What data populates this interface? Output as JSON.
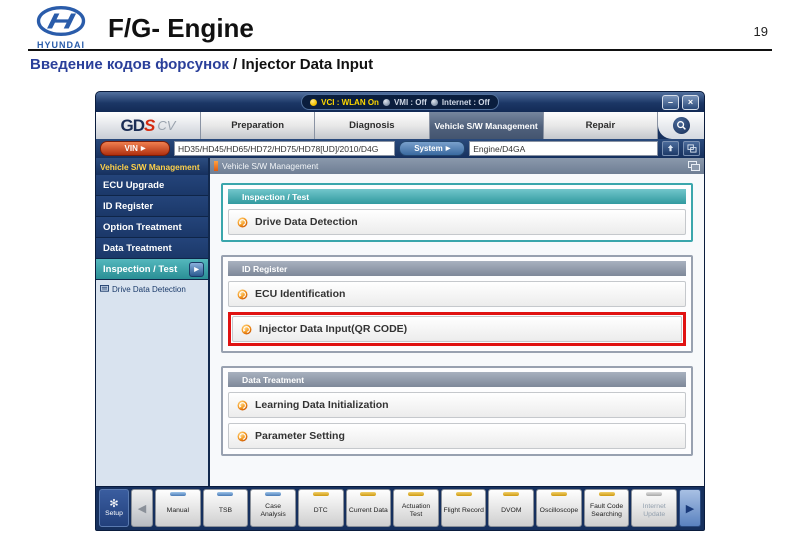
{
  "slide": {
    "brand": "HYUNDAI",
    "title": "F/G- Engine",
    "page_number": "19",
    "subtitle_ru": "Введение кодов форсунок",
    "subtitle_sep": " / ",
    "subtitle_en": "Injector Data Input"
  },
  "window": {
    "titlebar": {
      "vci": "VCI : WLAN On",
      "vmi": "VMI : Off",
      "internet": "Internet : Off"
    },
    "controls": {
      "minimize": "–",
      "close": "×"
    },
    "logo": {
      "gd": "GD",
      "s": "S",
      "cv": "CV"
    },
    "tabs": [
      {
        "label": "Preparation",
        "active": false
      },
      {
        "label": "Diagnosis",
        "active": false
      },
      {
        "label": "Vehicle S/W Management",
        "active": true
      },
      {
        "label": "Repair",
        "active": false
      }
    ],
    "vin_row": {
      "vin_label": "VIN",
      "vin_value": "HD35/HD45/HD65/HD72/HD75/HD78[UD]/2010/D4G",
      "system_label": "System",
      "system_value": "Engine/D4GA",
      "arrow": "▶"
    },
    "sidebar": {
      "header": "Vehicle S/W Management",
      "items": [
        "ECU Upgrade",
        "ID Register",
        "Option Treatment",
        "Data Treatment"
      ],
      "selected_item": "Inspection / Test",
      "selected_arrow": "▶",
      "sub_item": "Drive Data Detection"
    },
    "main": {
      "header": "Vehicle S/W Management",
      "sections": [
        {
          "title": "Inspection / Test",
          "style": "teal",
          "items": [
            {
              "label": "Drive Data Detection",
              "highlighted": false
            }
          ]
        },
        {
          "title": "ID Register",
          "style": "gray",
          "items": [
            {
              "label": "ECU Identification",
              "highlighted": false
            },
            {
              "label": "Injector Data Input(QR CODE)",
              "highlighted": true
            }
          ]
        },
        {
          "title": "Data Treatment",
          "style": "gray",
          "items": [
            {
              "label": "Learning Data Initialization",
              "highlighted": false
            },
            {
              "label": "Parameter Setting",
              "highlighted": false
            }
          ]
        }
      ]
    },
    "toolbar": {
      "setup_label": "Setup",
      "setup_icon": "✻",
      "prev_icon": "◀",
      "next_icon": "▶",
      "buttons": [
        {
          "label": "Manual",
          "bar": "blue",
          "disabled": false
        },
        {
          "label": "TSB",
          "bar": "blue",
          "disabled": false
        },
        {
          "label": "Case Analysis",
          "bar": "blue",
          "disabled": false
        },
        {
          "label": "DTC",
          "bar": "yellow",
          "disabled": false
        },
        {
          "label": "Current Data",
          "bar": "yellow",
          "disabled": false
        },
        {
          "label": "Actuation Test",
          "bar": "yellow",
          "disabled": false
        },
        {
          "label": "Flight Record",
          "bar": "yellow",
          "disabled": false
        },
        {
          "label": "DVOM",
          "bar": "yellow",
          "disabled": false
        },
        {
          "label": "Oscilloscope",
          "bar": "yellow",
          "disabled": false
        },
        {
          "label": "Fault Code Searching",
          "bar": "yellow",
          "disabled": false
        },
        {
          "label": "Internet Update",
          "bar": "gray",
          "disabled": true
        }
      ]
    }
  },
  "colors": {
    "navy_frame": "#16305e",
    "teal_accent": "#31999f",
    "gray_accent": "#7e8899",
    "orange_icon": "#f59a20",
    "highlight_red": "#e01212",
    "status_yellow": "#ffd800",
    "sidebar_gold": "#ffd24a",
    "hyundai_blue": "#2a5caa"
  }
}
